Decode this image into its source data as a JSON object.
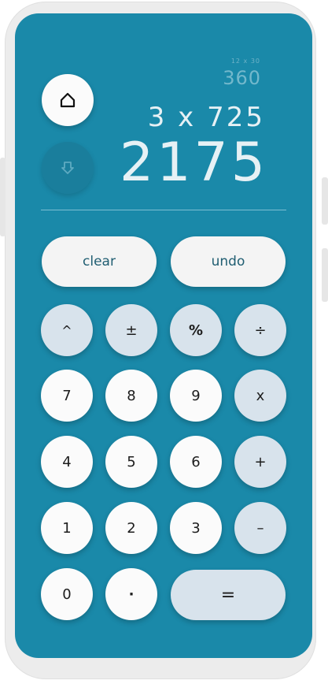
{
  "display": {
    "history_expression": "12 x 30",
    "history_result": "360",
    "current_expression": "3 x 725",
    "result": "2175"
  },
  "icons": {
    "home": "home-icon",
    "down": "arrow-down-icon"
  },
  "actions": {
    "clear_label": "clear",
    "undo_label": "undo"
  },
  "keys": {
    "power": "^",
    "plus_minus": "±",
    "percent": "%",
    "divide": "÷",
    "seven": "7",
    "eight": "8",
    "nine": "9",
    "multiply": "x",
    "four": "4",
    "five": "5",
    "six": "6",
    "add": "+",
    "one": "1",
    "two": "2",
    "three": "3",
    "subtract": "–",
    "zero": "0",
    "decimal": "·",
    "equals": "="
  },
  "colors": {
    "screen_background": "#1a89a9",
    "number_key": "#fbfbfb",
    "operator_key": "#d8e3ec",
    "display_text": "#e6f1f5"
  }
}
